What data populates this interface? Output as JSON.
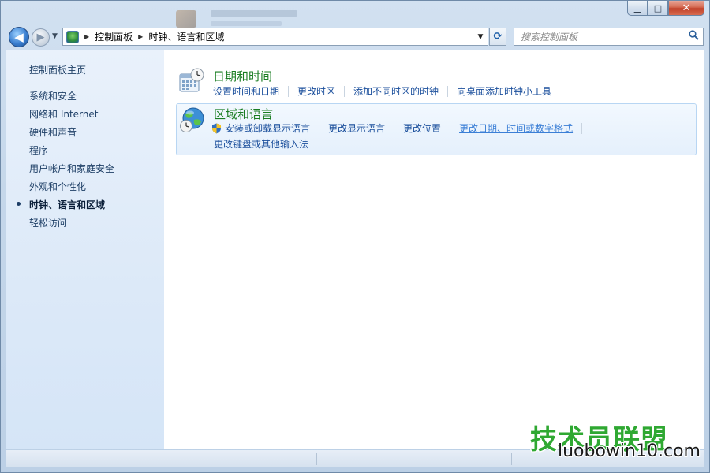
{
  "window": {
    "caption": {
      "minimize": "▁",
      "maximize": "□",
      "close": "✕"
    }
  },
  "nav": {
    "back_glyph": "◀",
    "forward_glyph": "▶",
    "breadcrumb": [
      "控制面板",
      "时钟、语言和区域"
    ],
    "refresh_glyph": "⟳"
  },
  "search": {
    "placeholder": "搜索控制面板"
  },
  "sidebar": {
    "home": "控制面板主页",
    "items": [
      {
        "label": "系统和安全"
      },
      {
        "label": "网络和 Internet"
      },
      {
        "label": "硬件和声音"
      },
      {
        "label": "程序"
      },
      {
        "label": "用户帐户和家庭安全"
      },
      {
        "label": "外观和个性化"
      },
      {
        "label": "时钟、语言和区域",
        "active": true
      },
      {
        "label": "轻松访问"
      }
    ]
  },
  "categories": [
    {
      "title": "日期和时间",
      "icon": "calendar-clock-icon",
      "links": [
        "设置时间和日期",
        "更改时区",
        "添加不同时区的时钟",
        "向桌面添加时钟小工具"
      ]
    },
    {
      "title": "区域和语言",
      "icon": "globe-clock-icon",
      "links_row1": [
        "安装或卸载显示语言",
        "更改显示语言",
        "更改位置",
        "更改日期、时间或数字格式"
      ],
      "links_row2": [
        "更改键盘或其他输入法"
      ]
    }
  ],
  "watermark": {
    "cn": "技术员联盟",
    "en": "luobowin10.com"
  },
  "colors": {
    "category_title": "#1a7d22",
    "link": "#1b4f9c",
    "sidebar_bg": "#dce9f8"
  }
}
